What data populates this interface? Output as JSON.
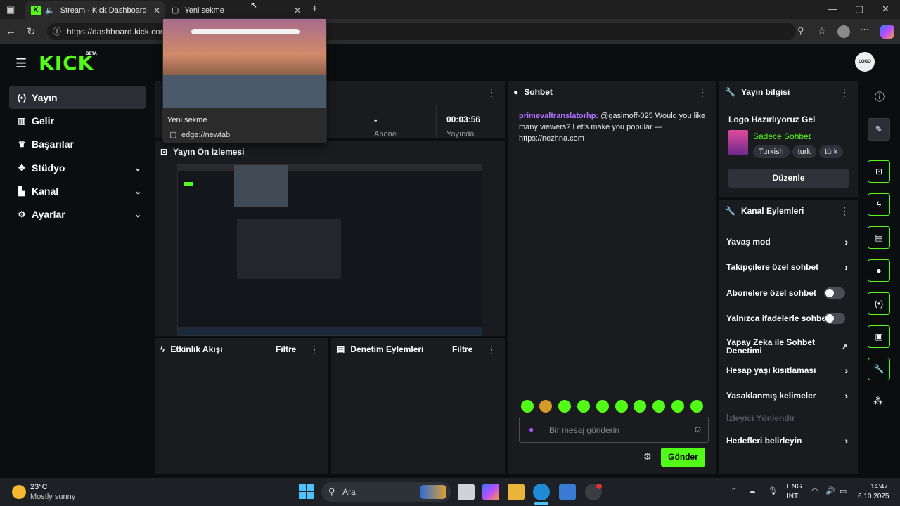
{
  "browser": {
    "tabs": [
      {
        "title": "Stream - Kick Dashboard"
      },
      {
        "title": "Yeni sekme"
      }
    ],
    "url": "https://dashboard.kick.com",
    "tooltip": {
      "title": "Yeni sekme",
      "url": "edge://newtab"
    }
  },
  "app": {
    "logo": "KICK",
    "logo_badge": "BETA",
    "avatar_label": "LOGO",
    "sidebar": [
      {
        "label": "Yayın",
        "icon": "broadcast-icon"
      },
      {
        "label": "Gelir",
        "icon": "revenue-icon"
      },
      {
        "label": "Başarılar",
        "icon": "trophy-icon"
      },
      {
        "label": "Stüdyo",
        "icon": "studio-icon"
      },
      {
        "label": "Kanal",
        "icon": "channel-icon"
      },
      {
        "label": "Ayarlar",
        "icon": "settings-icon"
      }
    ],
    "stats": {
      "value1": "-",
      "value2": "00:03:56",
      "label1": "Abone",
      "label2": "Yayında"
    },
    "preview_title": "Yayın Ön İzlemesi",
    "activity": {
      "title": "Etkinlik Akışı",
      "filter": "Filtre"
    },
    "moderation": {
      "title": "Denetim Eylemleri",
      "filter": "Filtre"
    },
    "chat": {
      "title": "Sohbet",
      "message": {
        "user": "primevaltranslatorhp",
        "text": "@gasimoff-025 Would you like many viewers? Let's make you popular — https://nezhna.com"
      },
      "input_placeholder": "Bir mesaj gönderin",
      "send_label": "Gönder"
    },
    "stream_info": {
      "title": "Yayın bilgisi",
      "stream_title": "Logo Hazırlıyoruz Gel",
      "category": "Sadece Sohbet",
      "tags": [
        "Turkish",
        "turk",
        "türk"
      ],
      "edit_label": "Düzenle"
    },
    "channel_actions": {
      "title": "Kanal Eylemleri",
      "items": [
        {
          "label": "Yavaş mod",
          "type": "arrow"
        },
        {
          "label": "Takipçilere özel sohbet",
          "type": "arrow"
        },
        {
          "label": "Abonelere özel sohbet",
          "type": "toggle"
        },
        {
          "label": "Yalnızca ifadelerle sohbet",
          "type": "toggle"
        },
        {
          "label": "Yapay Zeka ile Sohbet Denetimi",
          "type": "external"
        },
        {
          "label": "Hesap yaşı kısıtlaması",
          "type": "arrow"
        },
        {
          "label": "Yasaklanmış kelimeler",
          "type": "arrow"
        },
        {
          "label": "İzleyici Yönlendir",
          "type": "disabled"
        },
        {
          "label": "Hedefleri belirleyin",
          "type": "arrow"
        }
      ]
    }
  },
  "taskbar": {
    "weather_temp": "23°C",
    "weather_desc": "Mostly sunny",
    "search_label": "Ara",
    "lang1": "ENG",
    "lang2": "INTL",
    "time": "14:47",
    "date": "6.10.2025"
  },
  "colors": {
    "accent": "#53fc18",
    "username": "#b173ff"
  }
}
